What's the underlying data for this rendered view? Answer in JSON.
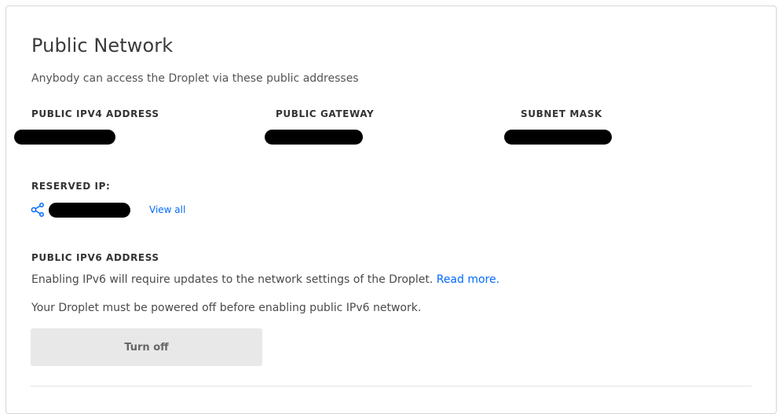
{
  "section": {
    "title": "Public Network",
    "subtitle": "Anybody can access the Droplet via these public addresses"
  },
  "ipv4": {
    "address_label": "PUBLIC IPV4 ADDRESS",
    "gateway_label": "PUBLIC GATEWAY",
    "subnet_label": "SUBNET MASK"
  },
  "reserved": {
    "label": "RESERVED IP:",
    "icon": "share-network-icon",
    "view_all": "View all"
  },
  "ipv6": {
    "label": "PUBLIC IPV6 ADDRESS",
    "info_text": "Enabling IPv6 will require updates to the network settings of the Droplet.",
    "read_more": "Read more.",
    "power_note": "Your Droplet must be powered off before enabling public IPv6 network.",
    "turn_off_button": "Turn off"
  },
  "colors": {
    "link": "#0069ff",
    "button_bg": "#e8e8e8",
    "redaction": "#000000"
  }
}
